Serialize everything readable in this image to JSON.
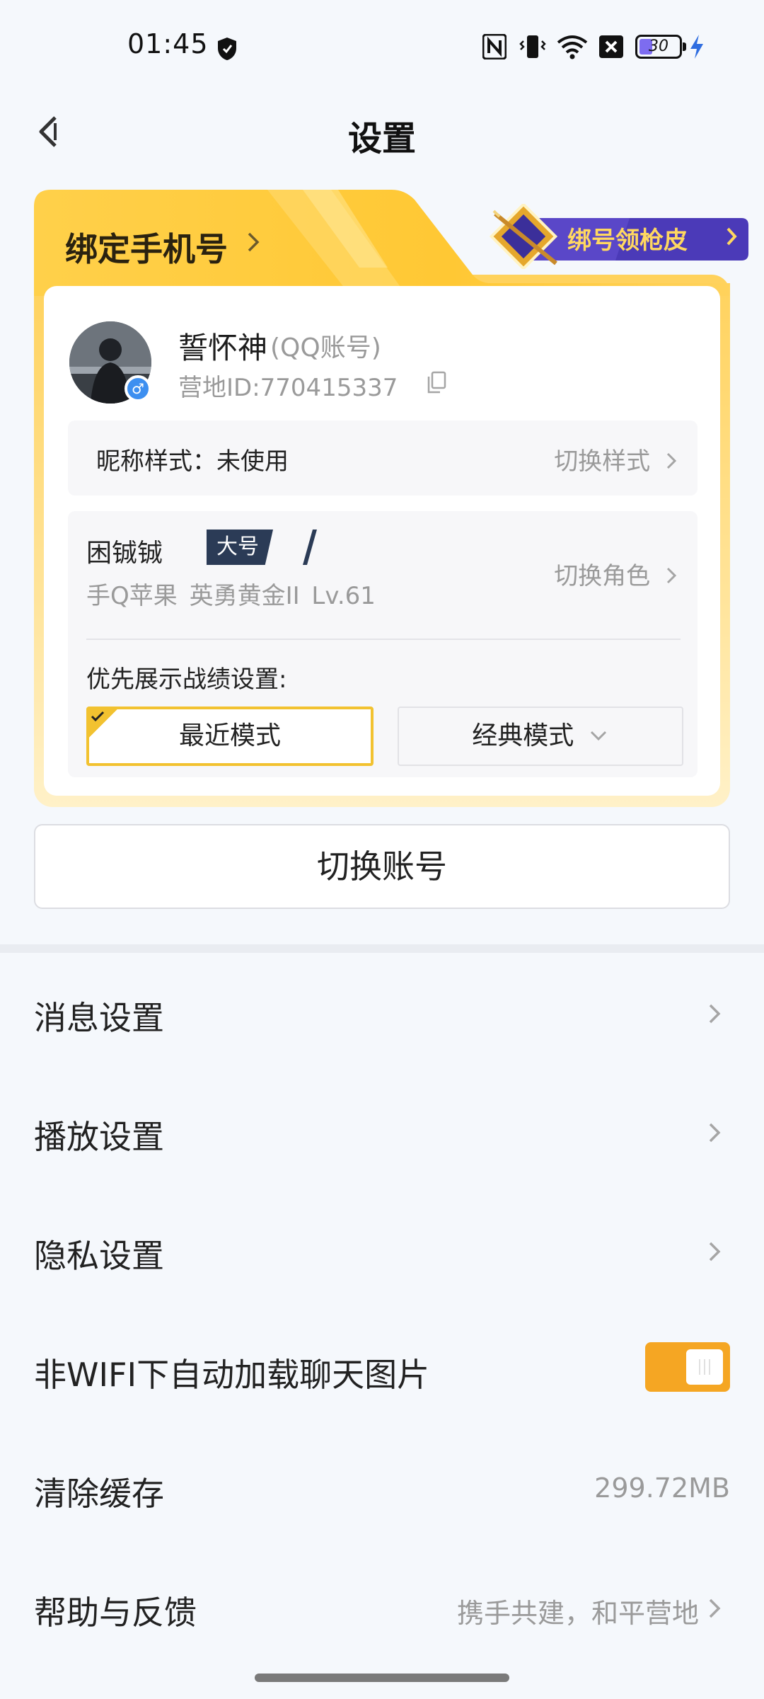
{
  "status_bar": {
    "time": "01:45",
    "battery_level": "30",
    "icons": [
      "nfc-icon",
      "vibrate-icon",
      "wifi-icon",
      "sim-off-icon",
      "battery-icon",
      "charging-icon"
    ]
  },
  "header": {
    "title": "设置"
  },
  "account_card": {
    "bind_phone_label": "绑定手机号",
    "bind_reward_label": "绑号领枪皮",
    "user_name": "誓怀神",
    "account_type": "(QQ账号)",
    "camp_id": "营地ID:770415337",
    "nickname_style_label": "昵称样式：未使用",
    "switch_style_label": "切换样式",
    "role_name": "困铖铖",
    "role_tag": "大号",
    "role_info": "手Q苹果  英勇黄金II  Lv.61",
    "switch_role_label": "切换角色",
    "record_setting_label": "优先展示战绩设置:",
    "mode_recent_label": "最近模式",
    "mode_classic_label": "经典模式"
  },
  "switch_account_label": "切换账号",
  "settings": {
    "message": "消息设置",
    "playback": "播放设置",
    "privacy": "隐私设置",
    "auto_load_images": "非WIFI下自动加载聊天图片",
    "auto_load_enabled": true,
    "clear_cache": "清除缓存",
    "cache_size": "299.72MB",
    "help_feedback": "帮助与反馈",
    "help_feedback_value": "携手共建，和平营地"
  },
  "colors": {
    "accent": "#f5a623",
    "card_gold": "#ffd25c",
    "role_tag_bg": "#2b3b56",
    "gender_badge": "#3d8ff0"
  }
}
